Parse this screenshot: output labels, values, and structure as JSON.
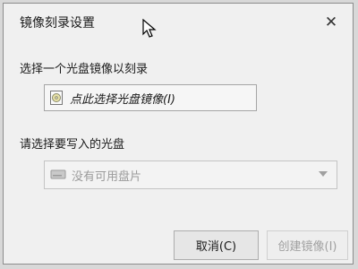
{
  "window": {
    "title": "镜像刻录设置",
    "close_label": "✕"
  },
  "image_section": {
    "label": "选择一个光盘镜像以刻录",
    "pick_label": "点此选择光盘镜像(I)"
  },
  "disc_section": {
    "label": "请选择要写入的光盘",
    "selected_value": "没有可用盘片"
  },
  "buttons": {
    "cancel_label": "取消(C)",
    "create_label": "创建镜像(I)"
  }
}
